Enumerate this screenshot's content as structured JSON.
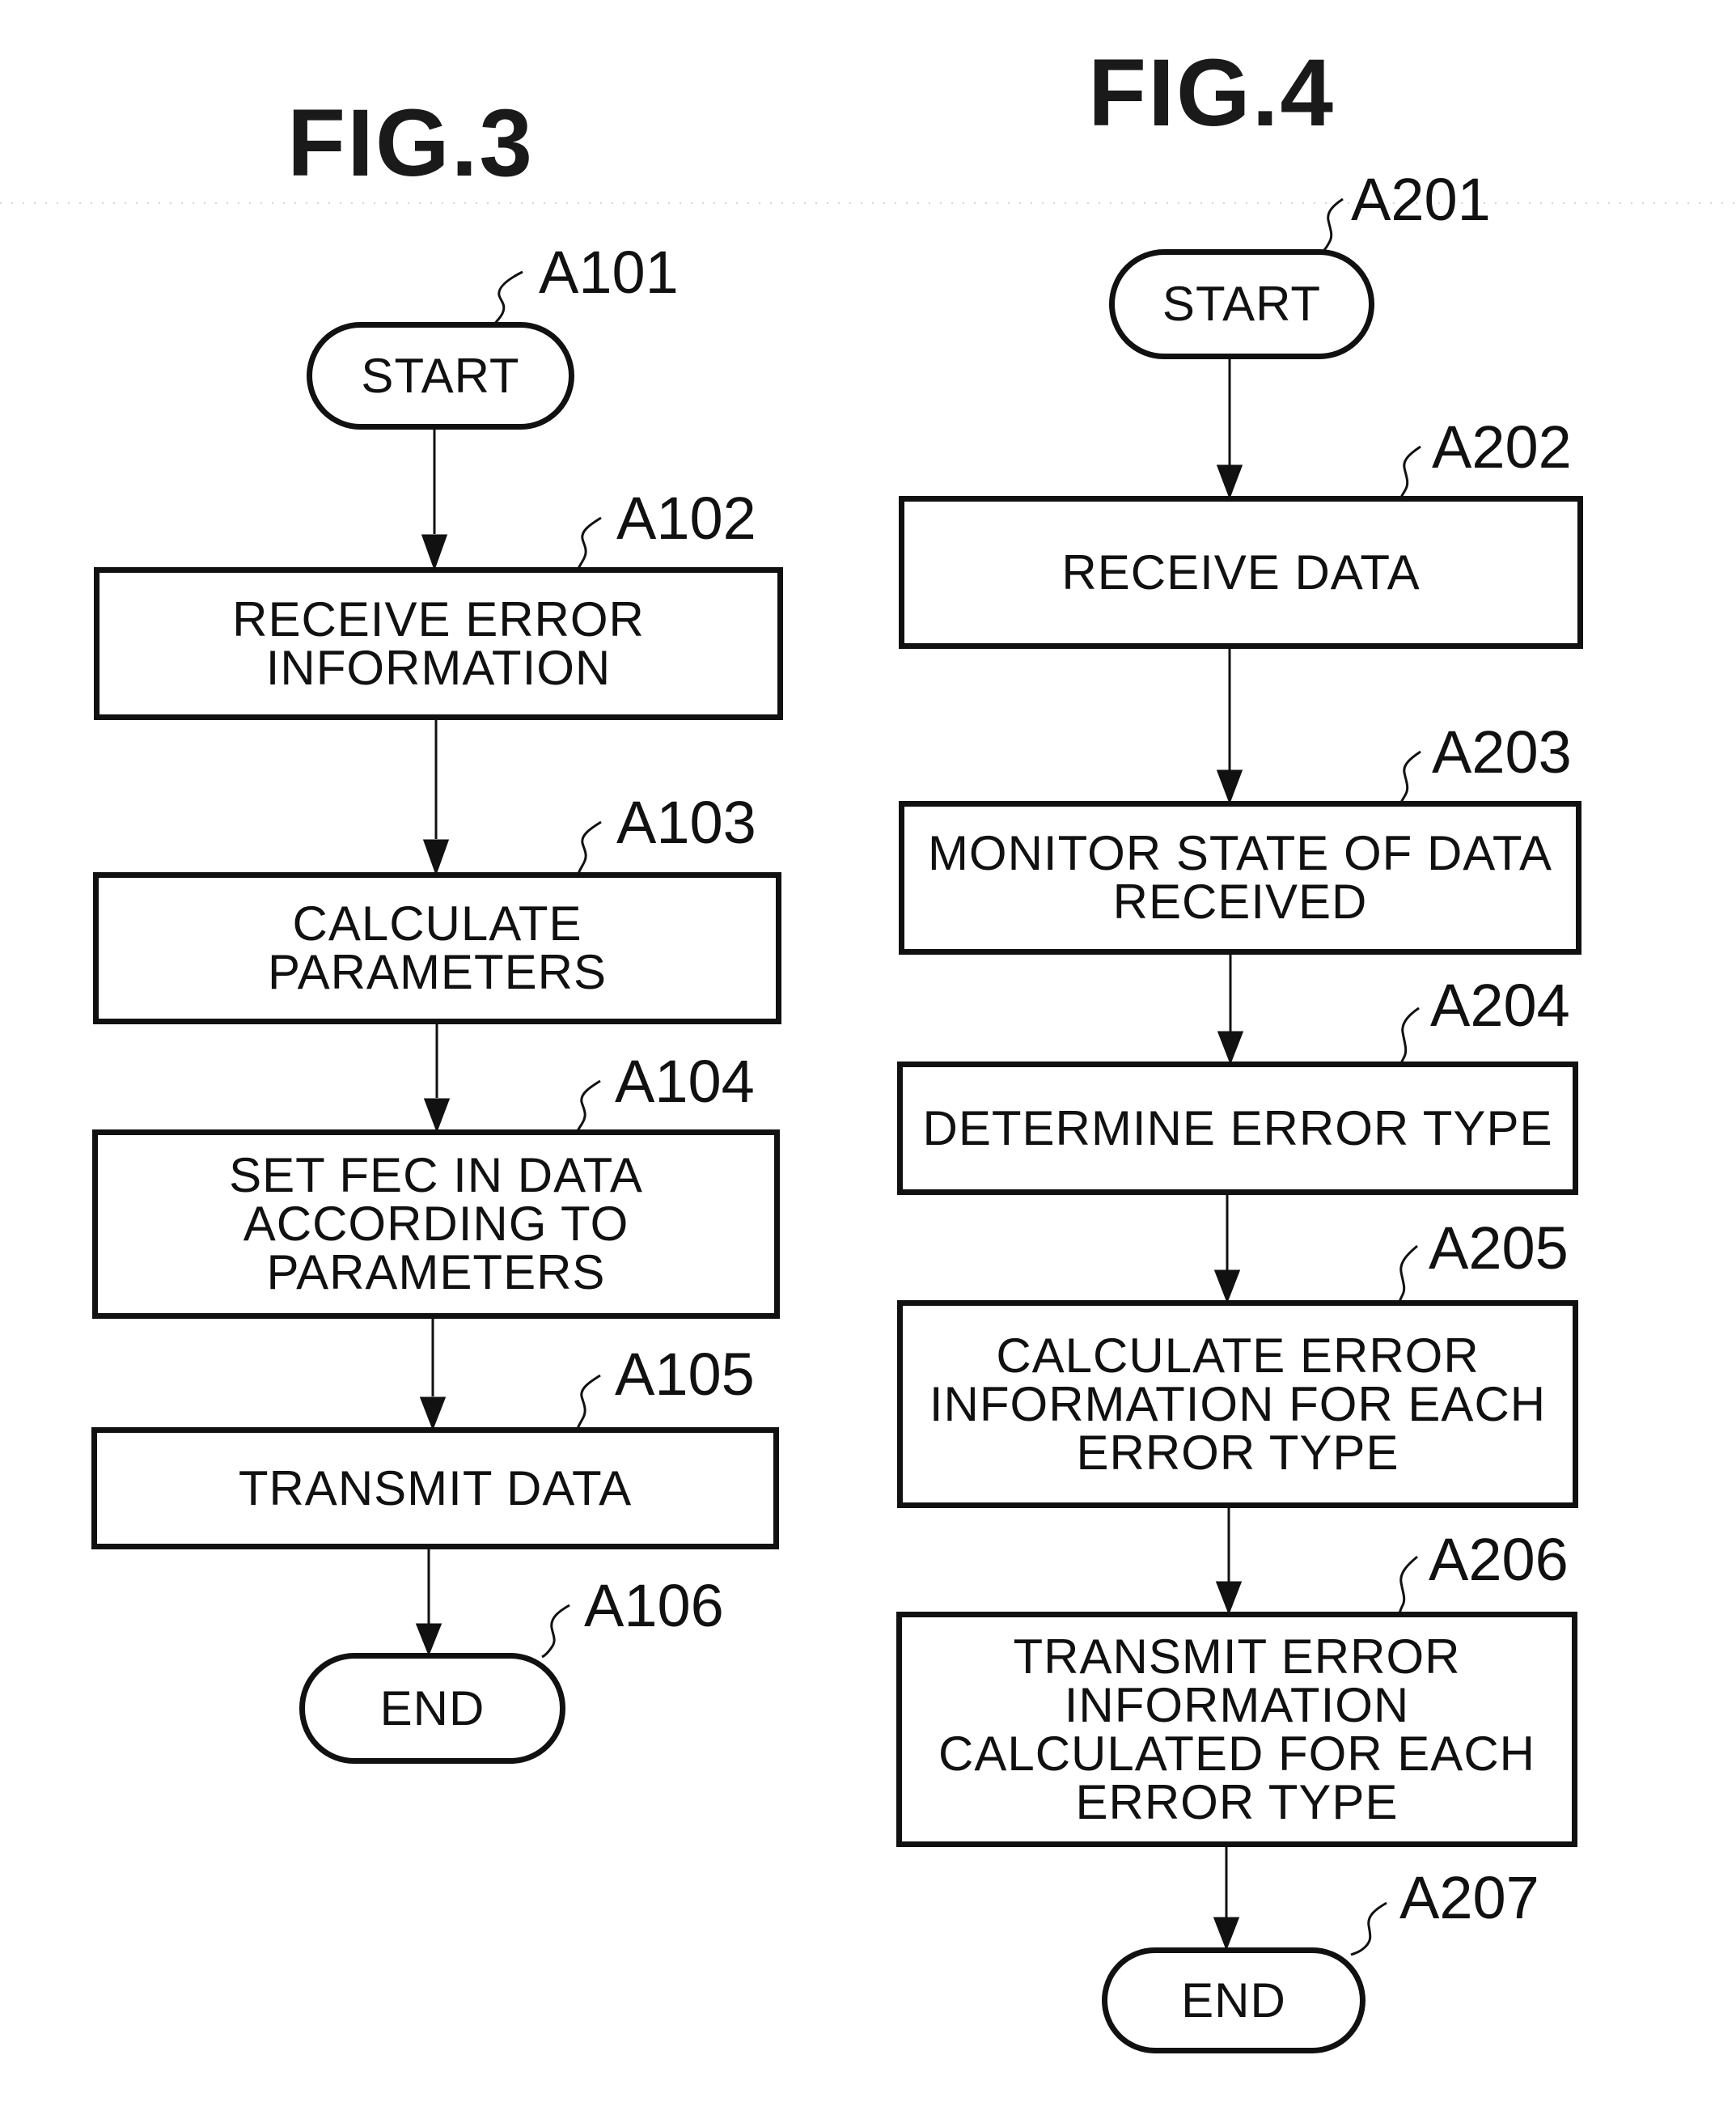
{
  "figures": [
    {
      "title": "FIG.3",
      "steps": [
        {
          "id": "A101",
          "type": "terminal",
          "text": "START"
        },
        {
          "id": "A102",
          "type": "process",
          "text": "RECEIVE ERROR\nINFORMATION"
        },
        {
          "id": "A103",
          "type": "process",
          "text": "CALCULATE\nPARAMETERS"
        },
        {
          "id": "A104",
          "type": "process",
          "text": "SET FEC IN DATA\nACCORDING TO\nPARAMETERS"
        },
        {
          "id": "A105",
          "type": "process",
          "text": "TRANSMIT DATA"
        },
        {
          "id": "A106",
          "type": "terminal",
          "text": "END"
        }
      ]
    },
    {
      "title": "FIG.4",
      "steps": [
        {
          "id": "A201",
          "type": "terminal",
          "text": "START"
        },
        {
          "id": "A202",
          "type": "process",
          "text": "RECEIVE DATA"
        },
        {
          "id": "A203",
          "type": "process",
          "text": "MONITOR STATE OF DATA\nRECEIVED"
        },
        {
          "id": "A204",
          "type": "process",
          "text": "DETERMINE ERROR TYPE"
        },
        {
          "id": "A205",
          "type": "process",
          "text": "CALCULATE ERROR\nINFORMATION FOR EACH\nERROR TYPE"
        },
        {
          "id": "A206",
          "type": "process",
          "text": "TRANSMIT ERROR\nINFORMATION\nCALCULATED FOR EACH\nERROR TYPE"
        },
        {
          "id": "A207",
          "type": "terminal",
          "text": "END"
        }
      ]
    }
  ]
}
